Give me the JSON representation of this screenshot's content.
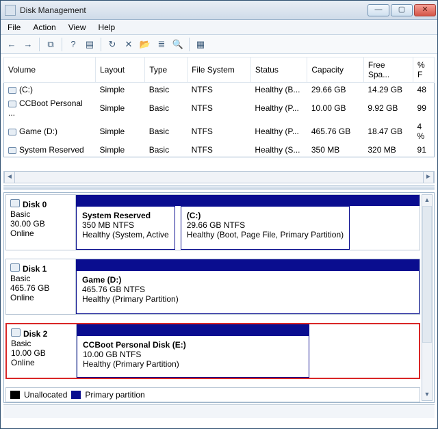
{
  "window": {
    "title": "Disk Management"
  },
  "menus": {
    "file": "File",
    "action": "Action",
    "view": "View",
    "help": "Help"
  },
  "tb": {
    "back": "←",
    "fwd": "→",
    "up": "⧉",
    "help": "?",
    "props": "▤",
    "refresh": "↻",
    "del": "✕",
    "open": "📂",
    "list": "≣",
    "find": "🔍",
    "extra": "▦"
  },
  "table": {
    "cols": {
      "volume": "Volume",
      "layout": "Layout",
      "type": "Type",
      "fs": "File System",
      "status": "Status",
      "capacity": "Capacity",
      "free": "Free Spa...",
      "pct": "% F"
    },
    "rows": [
      {
        "volume": "(C:)",
        "layout": "Simple",
        "type": "Basic",
        "fs": "NTFS",
        "status": "Healthy (B...",
        "capacity": "29.66 GB",
        "free": "14.29 GB",
        "pct": "48"
      },
      {
        "volume": "CCBoot Personal ...",
        "layout": "Simple",
        "type": "Basic",
        "fs": "NTFS",
        "status": "Healthy (P...",
        "capacity": "10.00 GB",
        "free": "9.92 GB",
        "pct": "99"
      },
      {
        "volume": "Game (D:)",
        "layout": "Simple",
        "type": "Basic",
        "fs": "NTFS",
        "status": "Healthy (P...",
        "capacity": "465.76 GB",
        "free": "18.47 GB",
        "pct": "4 %"
      },
      {
        "volume": "System Reserved",
        "layout": "Simple",
        "type": "Basic",
        "fs": "NTFS",
        "status": "Healthy (S...",
        "capacity": "350 MB",
        "free": "320 MB",
        "pct": "91"
      }
    ]
  },
  "disks": [
    {
      "name": "Disk 0",
      "type": "Basic",
      "size": "30.00 GB",
      "state": "Online",
      "parts": [
        {
          "title": "System Reserved",
          "sub": "350 MB NTFS",
          "stat": "Healthy (System, Active"
        },
        {
          "title": "(C:)",
          "sub": "29.66 GB NTFS",
          "stat": "Healthy (Boot, Page File, Primary Partition)"
        }
      ]
    },
    {
      "name": "Disk 1",
      "type": "Basic",
      "size": "465.76 GB",
      "state": "Online",
      "parts": [
        {
          "title": "Game  (D:)",
          "sub": "465.76 GB NTFS",
          "stat": "Healthy (Primary Partition)"
        }
      ]
    },
    {
      "name": "Disk 2",
      "type": "Basic",
      "size": "10.00 GB",
      "state": "Online",
      "highlight": true,
      "parts": [
        {
          "title": "CCBoot Personal Disk  (E:)",
          "sub": "10.00 GB NTFS",
          "stat": "Healthy (Primary Partition)"
        }
      ]
    }
  ],
  "legend": {
    "unalloc": "Unallocated",
    "primary": "Primary partition"
  }
}
